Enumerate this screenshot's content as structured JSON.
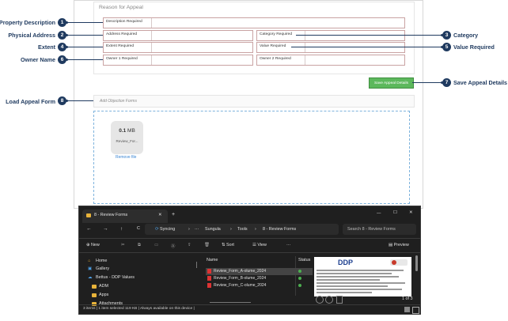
{
  "form": {
    "title": "Reason for Appeal",
    "fields": {
      "description": "Description Required",
      "address": "Address Required",
      "category": "Category Required",
      "extent": "Extent Required",
      "value": "Value Required",
      "owner1": "Owner 1 Required",
      "owner2": "Owner 2 Required"
    },
    "save_label": "Save Appeal Details",
    "upload_header": "Add Objection Forms",
    "file_size_num": "0.1",
    "file_size_unit": "MB",
    "file_name": "Review_For...",
    "remove_label": "Remove file"
  },
  "callouts": [
    {
      "num": "1",
      "label": "Property Description"
    },
    {
      "num": "2",
      "label": "Physical Address"
    },
    {
      "num": "3",
      "label": "Category"
    },
    {
      "num": "4",
      "label": "Extent"
    },
    {
      "num": "5",
      "label": "Value Required"
    },
    {
      "num": "6",
      "label": "Owner Name"
    },
    {
      "num": "7",
      "label": "Save Appeal Details"
    },
    {
      "num": "8",
      "label": "Load Appeal Form"
    }
  ],
  "explorer": {
    "tab_title": "8 - Review Forms",
    "tab_close": "✕",
    "tab_add": "+",
    "win_min": "—",
    "win_max": "☐",
    "win_close": "✕",
    "nav_back": "←",
    "nav_fwd": "→",
    "nav_up": "↑",
    "nav_refresh": "C",
    "syncing": "Syncing",
    "breadcrumb_more": "···",
    "breadcrumb": [
      "Sungula",
      "Tools",
      "8 - Review Forms"
    ],
    "search_placeholder": "Search 8 - Review Forms",
    "new_label": "New",
    "sort_label": "Sort",
    "view_label": "View",
    "more_label": "···",
    "preview_label": "Preview",
    "sidebar": [
      "Home",
      "Gallery",
      "Bettus - DDP Values",
      "ADM",
      "Apps",
      "Attachments"
    ],
    "col_name": "Name",
    "col_status": "Status",
    "files": [
      "Review_Form_A-olume_2024",
      "Review_Form_B-olume_2024",
      "Review_Form_C-olume_2024"
    ],
    "preview_logo": "DDP",
    "page_indicator": "1 of 3",
    "statusbar": "3 items  |  1 item selected  119 KB  |  Always available on this device  |"
  },
  "colors": {
    "callout": "#1f3a5f",
    "save_button": "#5cb85c",
    "dropzone_border": "#7eb3dd",
    "explorer_bg": "#1f1f1f",
    "sync_status": "#4caf50",
    "pdf_icon": "#dd3333",
    "folder_icon": "#e8b33a"
  }
}
